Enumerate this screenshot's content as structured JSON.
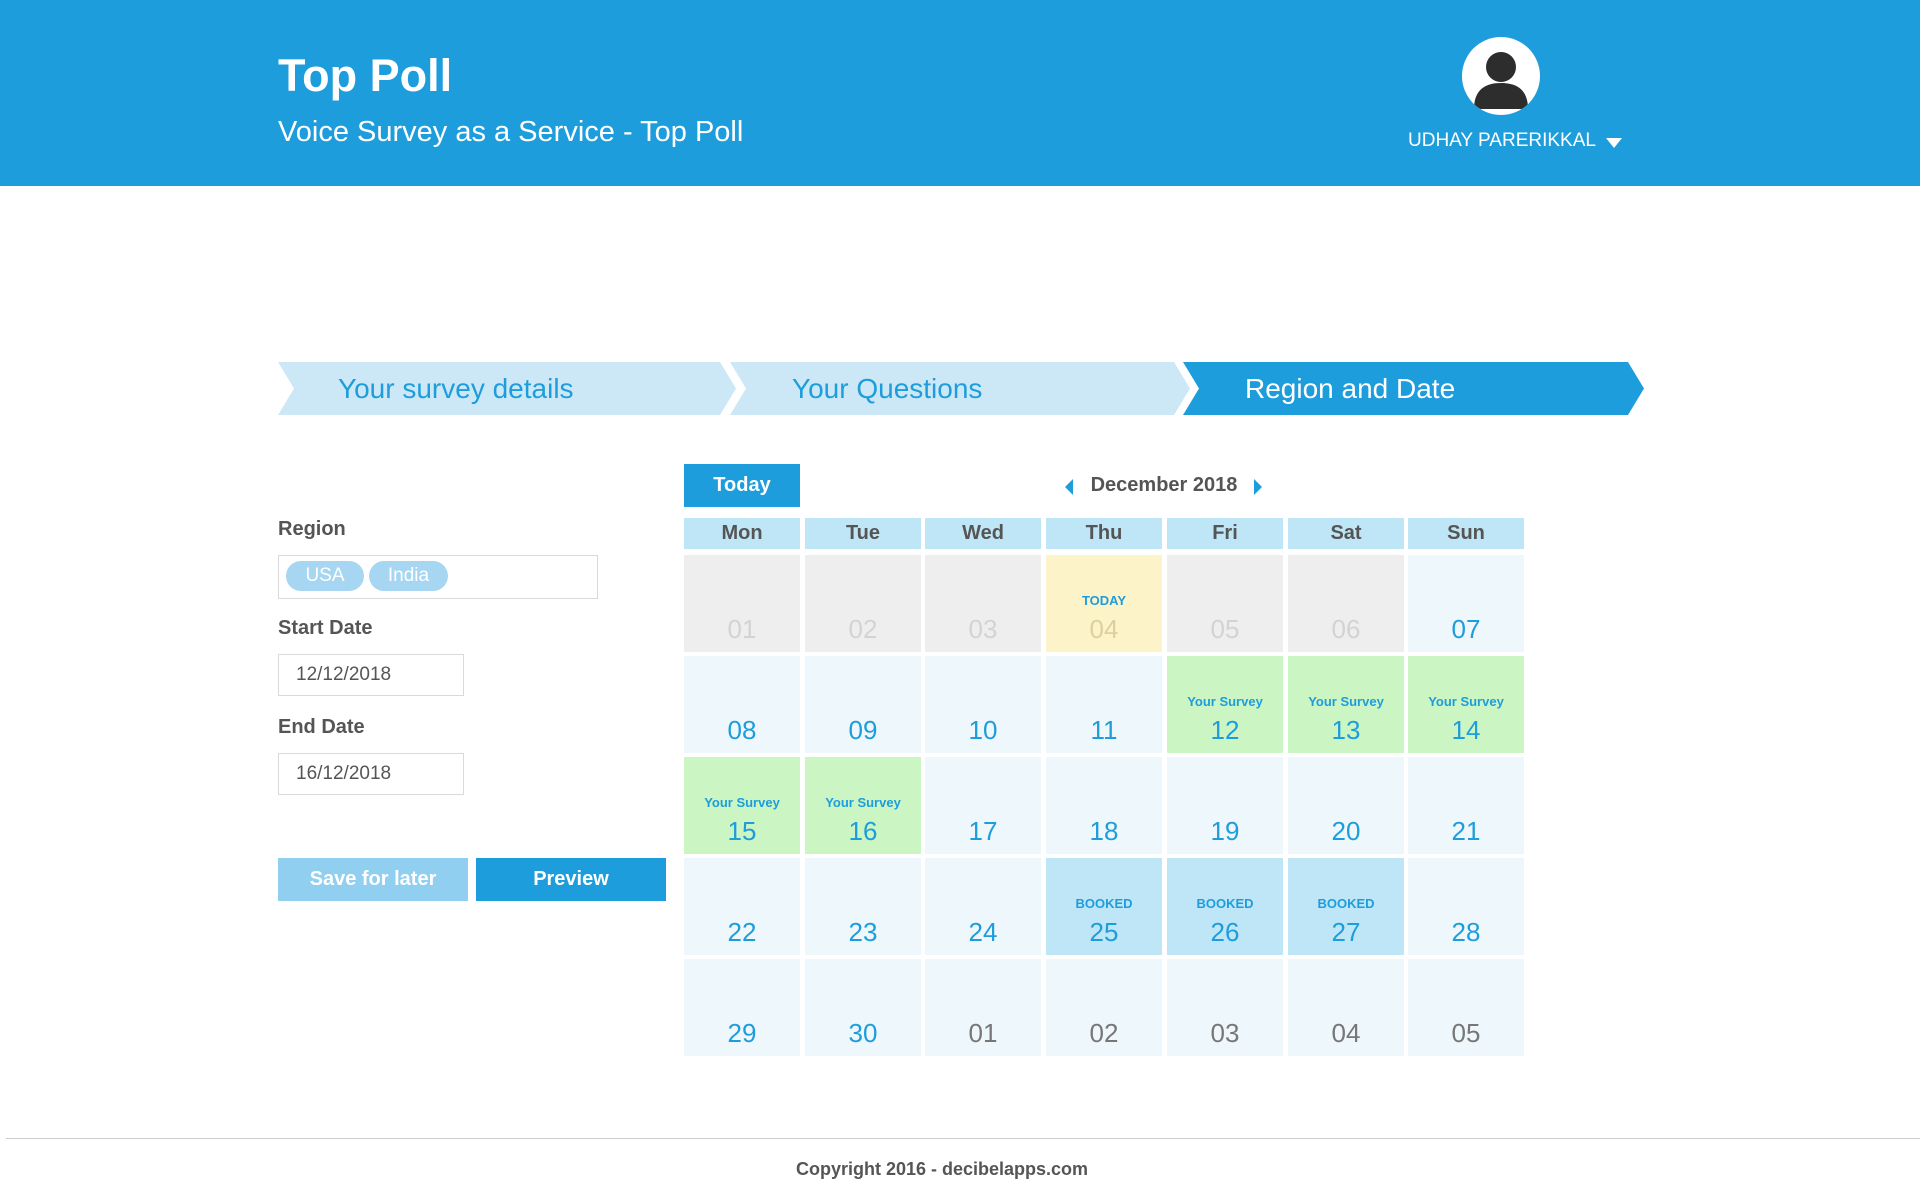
{
  "header": {
    "title": "Top Poll",
    "subtitle": "Voice Survey as a Service - Top Poll",
    "user_name": "UDHAY PARERIKKAL",
    "avatar_icon": "user-avatar-icon"
  },
  "steps": [
    {
      "label": "Your survey details",
      "state": "inactive"
    },
    {
      "label": "Your Questions",
      "state": "inactive"
    },
    {
      "label": "Region and Date",
      "state": "active"
    }
  ],
  "form": {
    "region_label": "Region",
    "regions": [
      "USA",
      "India"
    ],
    "start_label": "Start Date",
    "start_value": "12/12/2018",
    "end_label": "End Date",
    "end_value": "16/12/2018",
    "save_label": "Save for later",
    "preview_label": "Preview"
  },
  "calendar": {
    "today_button": "Today",
    "month": "December 2018",
    "weekdays": [
      "Mon",
      "Tue",
      "Wed",
      "Thu",
      "Fri",
      "Sat",
      "Sun"
    ],
    "weeks": [
      [
        {
          "day": "01",
          "state": "past"
        },
        {
          "day": "02",
          "state": "past"
        },
        {
          "day": "03",
          "state": "past"
        },
        {
          "day": "04",
          "state": "today",
          "tag": "TODAY"
        },
        {
          "day": "05",
          "state": "past"
        },
        {
          "day": "06",
          "state": "past"
        },
        {
          "day": "07",
          "state": "future"
        }
      ],
      [
        {
          "day": "08",
          "state": "future"
        },
        {
          "day": "09",
          "state": "future"
        },
        {
          "day": "10",
          "state": "future"
        },
        {
          "day": "11",
          "state": "future"
        },
        {
          "day": "12",
          "state": "survey",
          "tag": "Your Survey"
        },
        {
          "day": "13",
          "state": "survey",
          "tag": "Your Survey"
        },
        {
          "day": "14",
          "state": "survey",
          "tag": "Your Survey"
        }
      ],
      [
        {
          "day": "15",
          "state": "survey",
          "tag": "Your Survey"
        },
        {
          "day": "16",
          "state": "survey",
          "tag": "Your Survey"
        },
        {
          "day": "17",
          "state": "future"
        },
        {
          "day": "18",
          "state": "future"
        },
        {
          "day": "19",
          "state": "future"
        },
        {
          "day": "20",
          "state": "future"
        },
        {
          "day": "21",
          "state": "future"
        }
      ],
      [
        {
          "day": "22",
          "state": "future"
        },
        {
          "day": "23",
          "state": "future"
        },
        {
          "day": "24",
          "state": "future"
        },
        {
          "day": "25",
          "state": "booked",
          "tag": "BOOKED"
        },
        {
          "day": "26",
          "state": "booked",
          "tag": "BOOKED"
        },
        {
          "day": "27",
          "state": "booked",
          "tag": "BOOKED"
        },
        {
          "day": "28",
          "state": "future"
        }
      ],
      [
        {
          "day": "29",
          "state": "future"
        },
        {
          "day": "30",
          "state": "future"
        },
        {
          "day": "01",
          "state": "next"
        },
        {
          "day": "02",
          "state": "next"
        },
        {
          "day": "03",
          "state": "next"
        },
        {
          "day": "04",
          "state": "next"
        },
        {
          "day": "05",
          "state": "next"
        }
      ]
    ]
  },
  "footer": {
    "copyright": "Copyright 2016 - decibelapps.com"
  },
  "colors": {
    "brand": "#1e9ddc",
    "step_inactive": "#cce8f7",
    "survey": "#cbf5c3",
    "booked": "#bfe6f6",
    "today": "#fdf3c8",
    "past": "#eeeeee"
  }
}
